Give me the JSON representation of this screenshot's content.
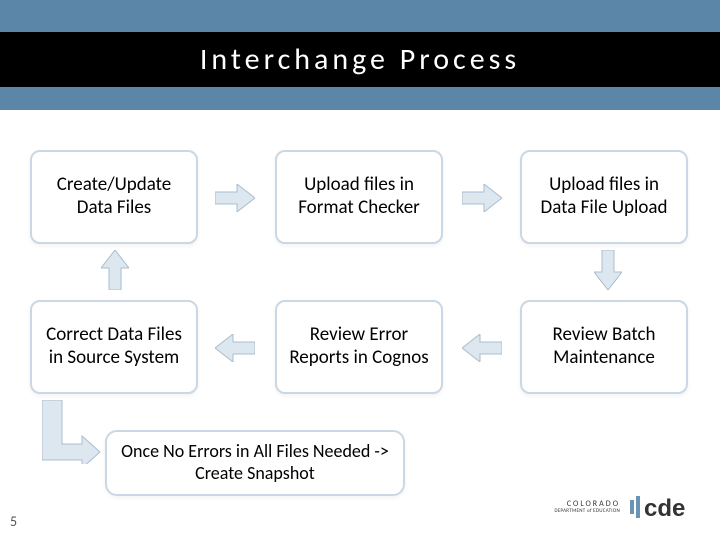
{
  "title": "Interchange Process",
  "boxes": {
    "r1c1": "Create/Update Data Files",
    "r1c2": "Upload files in Format Checker",
    "r1c3": "Upload files in Data File Upload",
    "r2c1": "Correct Data Files in Source System",
    "r2c2": "Review Error Reports in Cognos",
    "r2c3": "Review Batch Maintenance",
    "final": "Once No Errors in All Files Needed -> Create Snapshot"
  },
  "page_number": "5",
  "logo": {
    "line1": "COLORADO",
    "line2": "DEPARTMENT of EDUCATION",
    "mark": "cde"
  },
  "colors": {
    "band": "#5b86a8",
    "box_border": "#c9d8e4",
    "arrow_fill": "#dde7ef",
    "arrow_stroke": "#a9bdce"
  }
}
